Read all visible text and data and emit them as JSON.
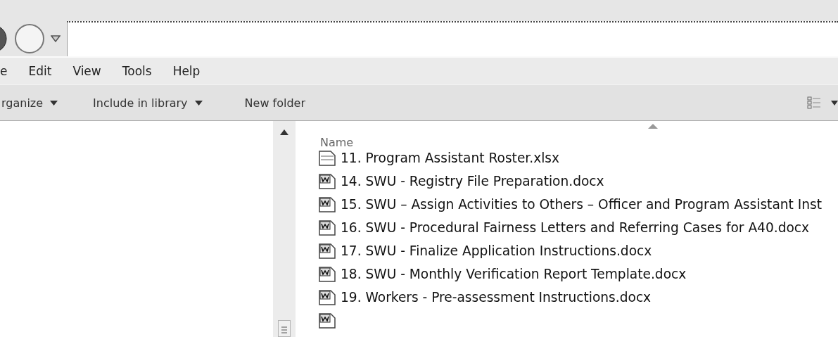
{
  "menu": [
    {
      "label": "e"
    },
    {
      "label": "Edit"
    },
    {
      "label": "View"
    },
    {
      "label": "Tools"
    },
    {
      "label": "Help"
    }
  ],
  "toolbar": [
    {
      "label": "rganize",
      "dropdown": true
    },
    {
      "label": "Include in library",
      "dropdown": true
    },
    {
      "label": "New folder",
      "dropdown": false
    }
  ],
  "file_list": {
    "column": "Name",
    "sort_ascending": true,
    "files": [
      {
        "name": "11. Program Assistant Roster.xlsx",
        "kind": "excel"
      },
      {
        "name": "14. SWU - Registry File Preparation.docx",
        "kind": "word"
      },
      {
        "name": "15. SWU – Assign Activities to Others – Officer and Program Assistant Inst",
        "kind": "word"
      },
      {
        "name": "16. SWU - Procedural Fairness Letters and Referring Cases for A40.docx",
        "kind": "word"
      },
      {
        "name": "17. SWU - Finalize Application Instructions.docx",
        "kind": "word"
      },
      {
        "name": "18. SWU - Monthly Verification Report Template.docx",
        "kind": "word"
      },
      {
        "name": "19. Workers - Pre-assessment Instructions.docx",
        "kind": "word"
      },
      {
        "kind": "word"
      }
    ]
  }
}
